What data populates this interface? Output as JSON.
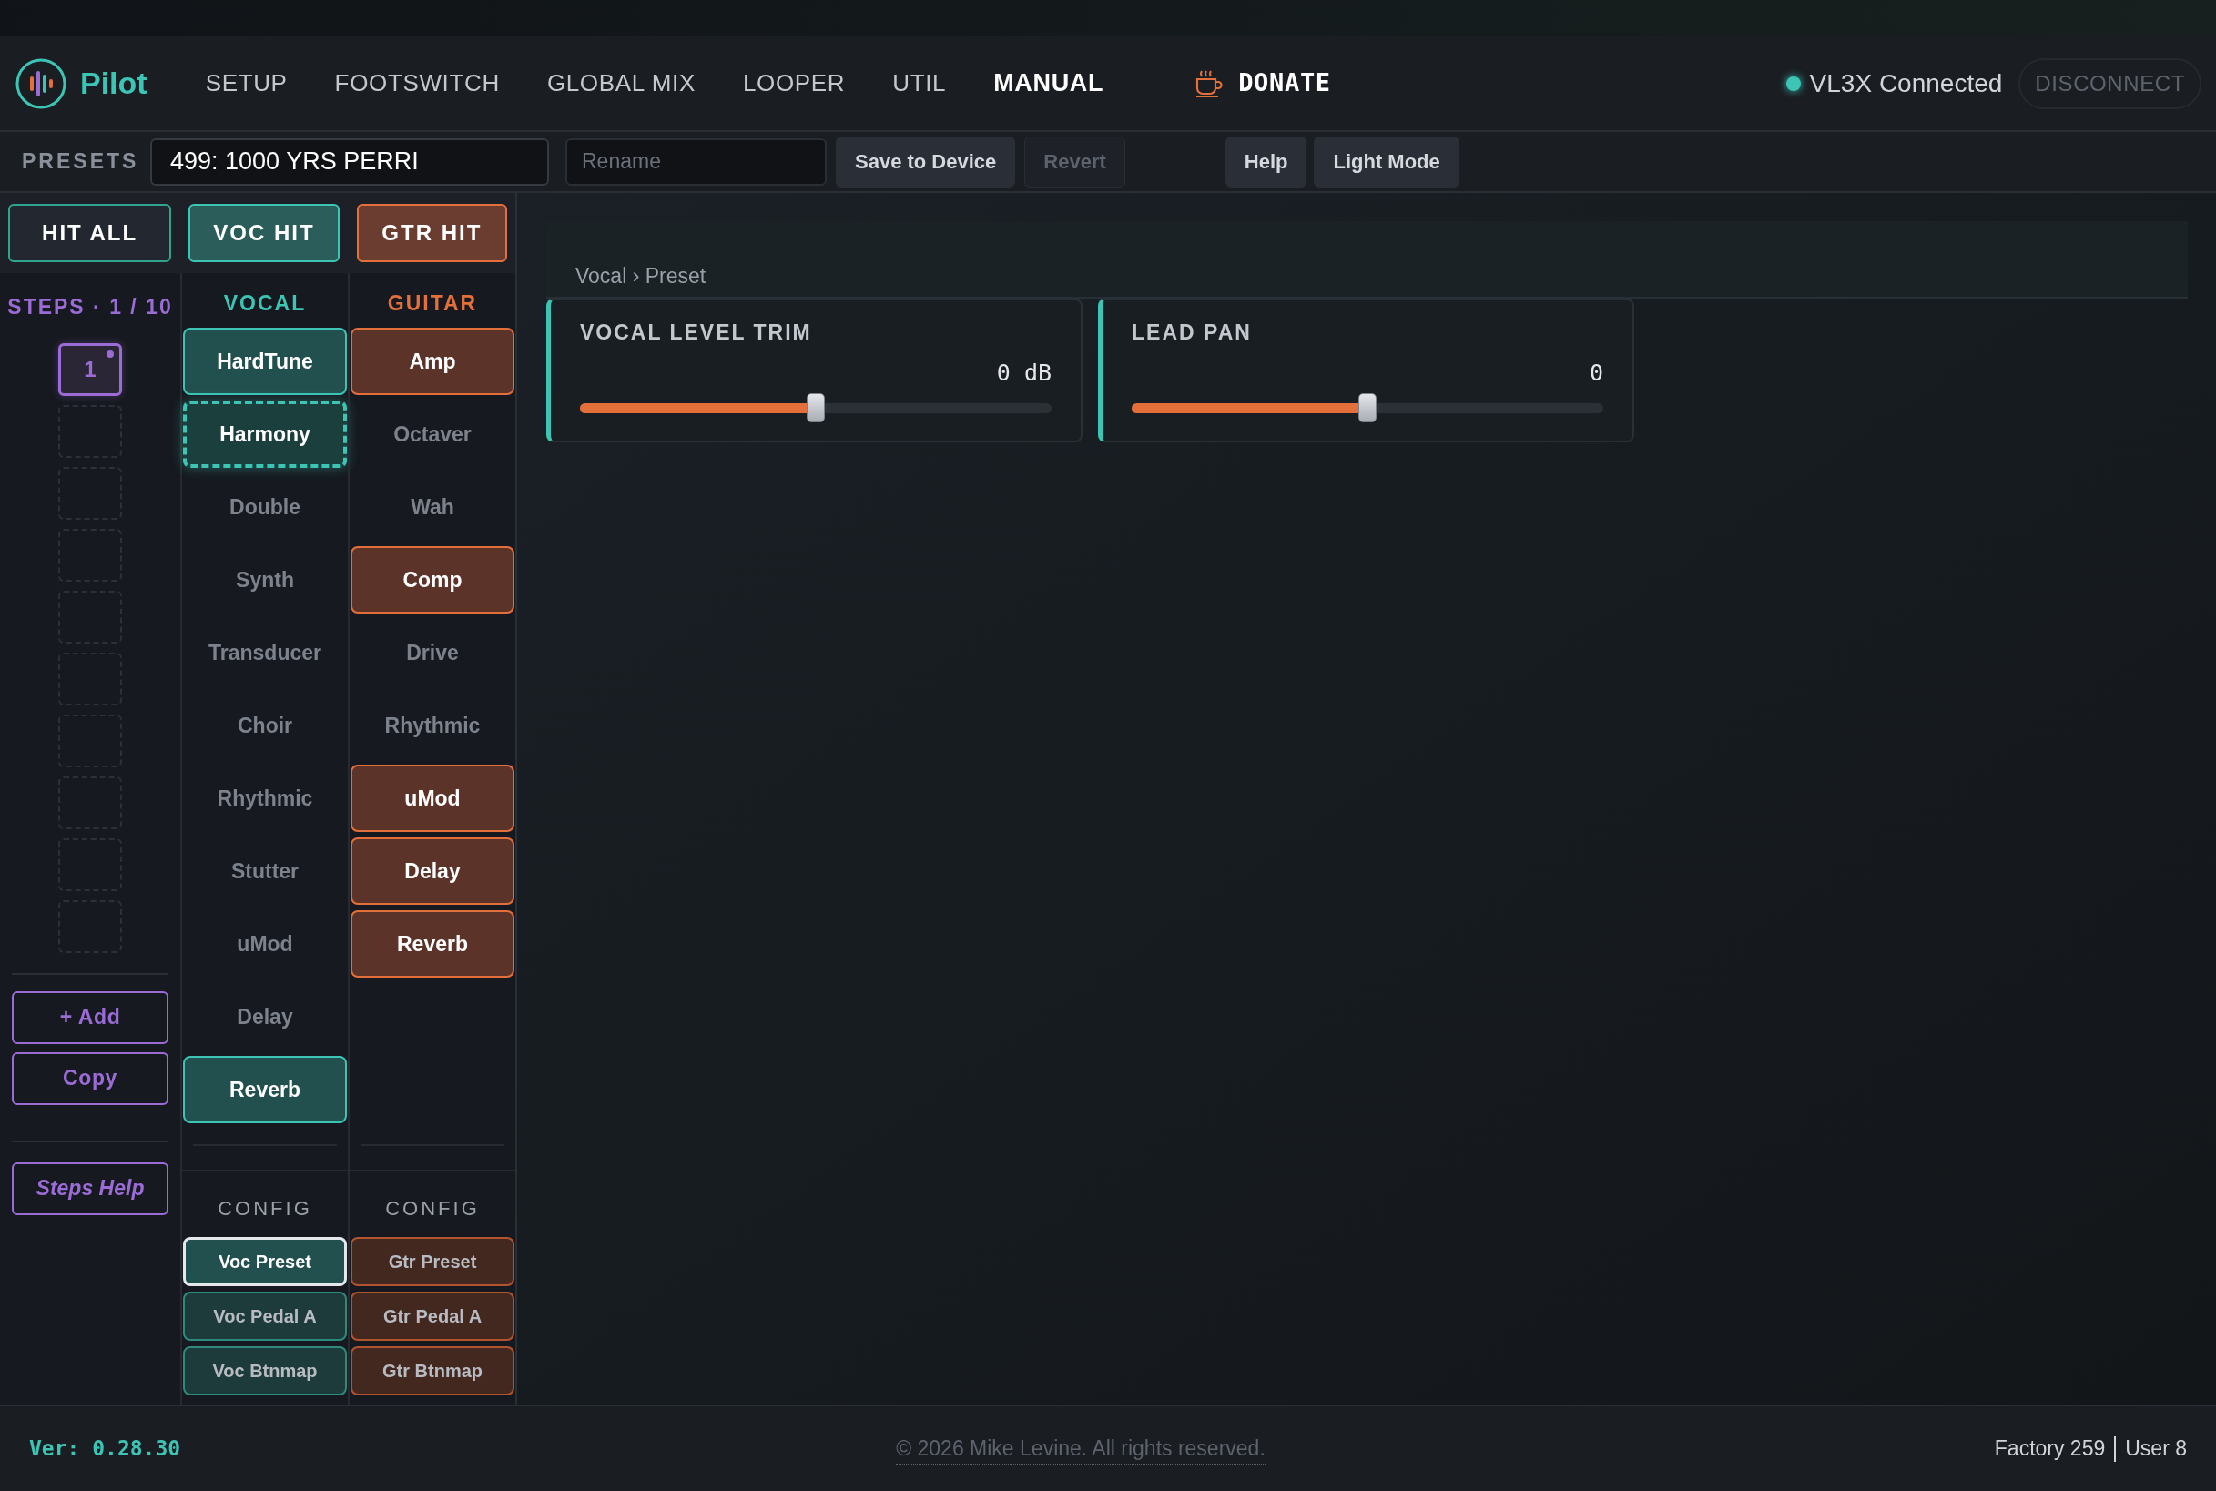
{
  "nav": {
    "logo": "Pilot",
    "tabs": [
      {
        "label": "SETUP",
        "selected": false
      },
      {
        "label": "FOOTSWITCH",
        "selected": false
      },
      {
        "label": "GLOBAL MIX",
        "selected": false
      },
      {
        "label": "LOOPER",
        "selected": false
      },
      {
        "label": "UTIL",
        "selected": false
      },
      {
        "label": "MANUAL",
        "selected": true
      }
    ],
    "donate": "DONATE",
    "status": {
      "text": "VL3X Connected",
      "connected": true
    },
    "disconnect": "DISCONNECT"
  },
  "presets_bar": {
    "label": "PRESETS",
    "preset": "499: 1000 YRS PERRI",
    "rename_placeholder": "Rename",
    "buttons": [
      {
        "label": "Save to Device",
        "disabled": false,
        "kind": "action"
      },
      {
        "label": "Revert",
        "disabled": true,
        "kind": "action"
      },
      {
        "label": "Help",
        "disabled": false,
        "kind": "util"
      },
      {
        "label": "Light Mode",
        "disabled": false,
        "kind": "util"
      }
    ]
  },
  "hit_buttons": [
    {
      "label": "HIT ALL",
      "kind": "all"
    },
    {
      "label": "VOC HIT",
      "kind": "vocal"
    },
    {
      "label": "GTR HIT",
      "kind": "guitar"
    }
  ],
  "steps": {
    "title": "STEPS · 1 / 10",
    "slots": [
      {
        "kind": "step",
        "label": "1",
        "selected": true
      },
      {
        "kind": "empty"
      },
      {
        "kind": "empty"
      },
      {
        "kind": "empty"
      },
      {
        "kind": "empty"
      },
      {
        "kind": "empty"
      },
      {
        "kind": "empty"
      },
      {
        "kind": "empty"
      },
      {
        "kind": "empty"
      },
      {
        "kind": "empty"
      }
    ],
    "buttons": [
      {
        "label": "+ Add",
        "kind": "action"
      },
      {
        "label": "Copy",
        "kind": "action"
      },
      {
        "label": "Steps Help",
        "kind": "help"
      }
    ]
  },
  "columns": [
    {
      "kind": "vocal",
      "title": "VOCAL",
      "effects": [
        {
          "label": "HardTune",
          "on": true,
          "selected": false
        },
        {
          "label": "Harmony",
          "on": true,
          "selected": true
        },
        {
          "label": "Double",
          "on": false,
          "selected": false
        },
        {
          "label": "Synth",
          "on": false,
          "selected": false
        },
        {
          "label": "Transducer",
          "on": false,
          "selected": false
        },
        {
          "label": "Choir",
          "on": false,
          "selected": false
        },
        {
          "label": "Rhythmic",
          "on": false,
          "selected": false
        },
        {
          "label": "Stutter",
          "on": false,
          "selected": false
        },
        {
          "label": "uMod",
          "on": false,
          "selected": false
        },
        {
          "label": "Delay",
          "on": false,
          "selected": false
        },
        {
          "label": "Reverb",
          "on": true,
          "selected": false
        }
      ],
      "config_title": "CONFIG",
      "config": [
        {
          "label": "Voc Preset",
          "selected": true
        },
        {
          "label": "Voc Pedal A",
          "selected": false
        },
        {
          "label": "Voc Btnmap",
          "selected": false
        }
      ]
    },
    {
      "kind": "guitar",
      "title": "GUITAR",
      "effects": [
        {
          "label": "Amp",
          "on": true,
          "selected": false
        },
        {
          "label": "Octaver",
          "on": false,
          "selected": false
        },
        {
          "label": "Wah",
          "on": false,
          "selected": false
        },
        {
          "label": "Comp",
          "on": true,
          "selected": false
        },
        {
          "label": "Drive",
          "on": false,
          "selected": false
        },
        {
          "label": "Rhythmic",
          "on": false,
          "selected": false
        },
        {
          "label": "uMod",
          "on": true,
          "selected": false
        },
        {
          "label": "Delay",
          "on": true,
          "selected": false
        },
        {
          "label": "Reverb",
          "on": true,
          "selected": false
        }
      ],
      "config_title": "CONFIG",
      "config": [
        {
          "label": "Gtr Preset",
          "selected": false
        },
        {
          "label": "Gtr Pedal A",
          "selected": false
        },
        {
          "label": "Gtr Btnmap",
          "selected": false
        }
      ]
    }
  ],
  "panel": {
    "breadcrumb": "Vocal › Preset",
    "params": [
      {
        "title": "VOCAL LEVEL TRIM",
        "reading": "0 dB",
        "level": 0.5
      },
      {
        "title": "LEAD PAN",
        "reading": "0",
        "level": 0.5
      }
    ]
  },
  "footer": {
    "version": "Ver: 0.28.30",
    "copyright": "© 2026 Mike Levine. All rights reserved.",
    "counts": [
      "Factory 259",
      "User 8"
    ]
  }
}
